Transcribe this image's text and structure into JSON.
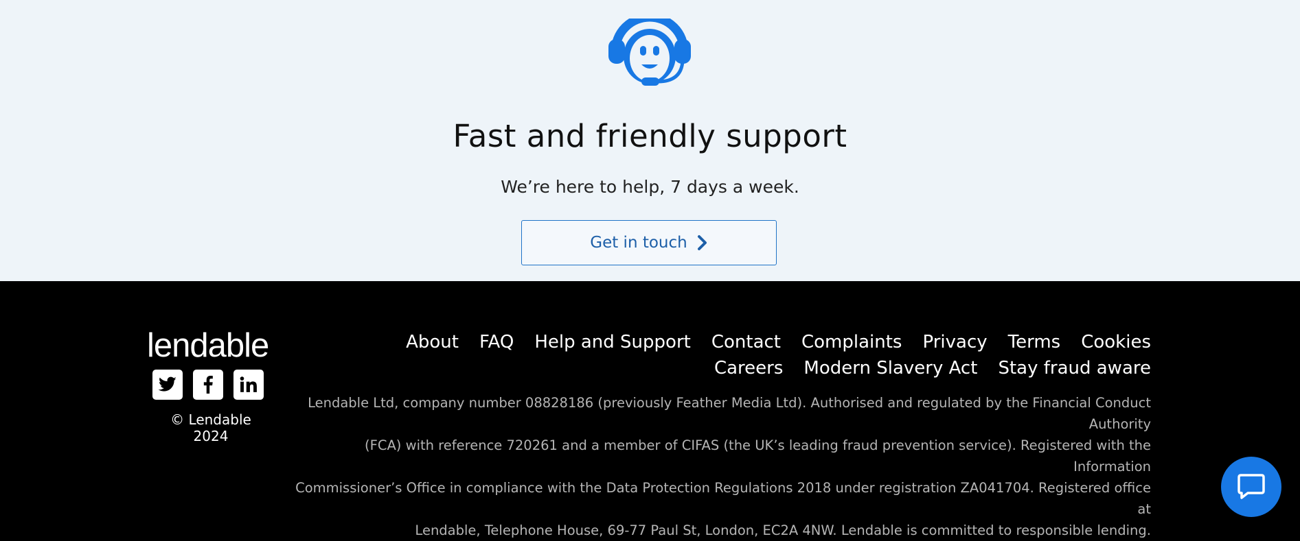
{
  "support": {
    "title": "Fast and friendly support",
    "subtitle": "We’re here to help, 7 days a week.",
    "cta_label": "Get in touch",
    "icon": "headset-agent-icon",
    "accent_color": "#1878e4"
  },
  "footer": {
    "logo_text": "lendable",
    "socials": [
      {
        "name": "twitter",
        "icon": "twitter-icon"
      },
      {
        "name": "facebook",
        "icon": "facebook-icon"
      },
      {
        "name": "linkedin",
        "icon": "linkedin-icon"
      }
    ],
    "copyright": "© Lendable 2024",
    "links": [
      "About",
      "FAQ",
      "Help and Support",
      "Contact",
      "Complaints",
      "Privacy",
      "Terms",
      "Cookies",
      "Careers",
      "Modern Slavery Act",
      "Stay fraud aware"
    ],
    "legal": [
      "Lendable Ltd, company number 08828186 (previously Feather Media Ltd). Authorised and regulated by the Financial Conduct Authority",
      "(FCA) with reference 720261 and a member of CIFAS (the UK’s leading fraud prevention service). Registered with the Information",
      "Commissioner’s Office in compliance with the Data Protection Regulations 2018 under registration ZA041704. Registered office at",
      "Lendable, Telephone House, 69-77 Paul St, London, EC2A 4NW. Lendable is committed to responsible lending."
    ]
  },
  "chat": {
    "icon": "chat-bubble-icon",
    "color": "#1878e4"
  }
}
